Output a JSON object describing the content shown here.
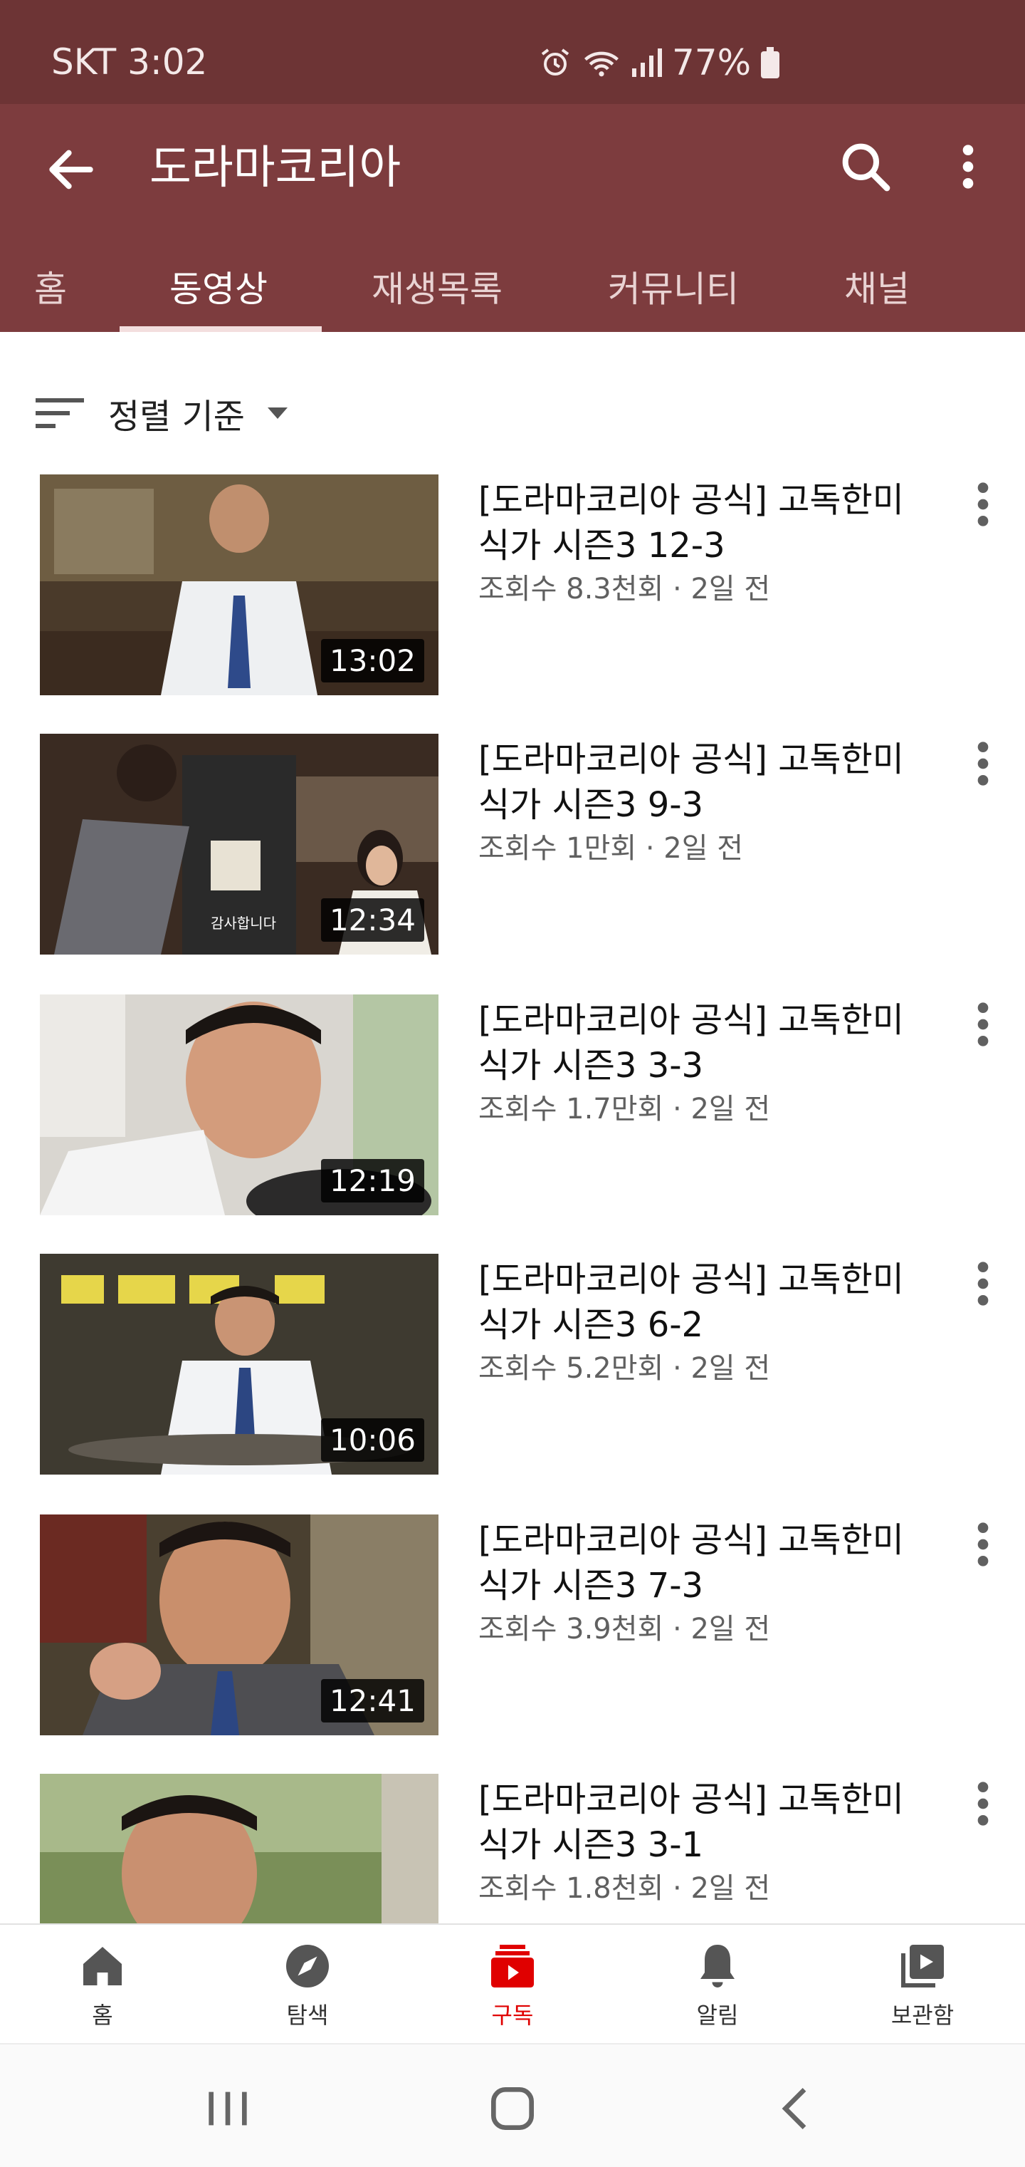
{
  "status_bar": {
    "carrier_time": "SKT 3:02",
    "battery": "77%"
  },
  "header": {
    "channel_title": "도라마코리아"
  },
  "tabs": [
    {
      "label": "홈"
    },
    {
      "label": "동영상",
      "active": true
    },
    {
      "label": "재생목록"
    },
    {
      "label": "커뮤니티"
    },
    {
      "label": "채널"
    }
  ],
  "sort": {
    "label": "정렬 기준"
  },
  "videos": [
    {
      "title": "[도라마코리아 공식] 고독한미식가 시즌3 12-3",
      "meta": "조회수 8.3천회 · 2일 전",
      "duration": "13:02"
    },
    {
      "title": "[도라마코리아 공식] 고독한미식가 시즌3 9-3",
      "meta": "조회수 1만회 · 2일 전",
      "duration": "12:34",
      "caption": "감사합니다"
    },
    {
      "title": "[도라마코리아 공식] 고독한미식가 시즌3 3-3",
      "meta": "조회수 1.7만회 · 2일 전",
      "duration": "12:19"
    },
    {
      "title": "[도라마코리아 공식] 고독한미식가 시즌3 6-2",
      "meta": "조회수 5.2만회 · 2일 전",
      "duration": "10:06"
    },
    {
      "title": "[도라마코리아 공식] 고독한미식가 시즌3 7-3",
      "meta": "조회수 3.9천회 · 2일 전",
      "duration": "12:41"
    },
    {
      "title": "[도라마코리아 공식] 고독한미식가 시즌3 3-1",
      "meta": "조회수 1.8천회 · 2일 전",
      "duration": ""
    }
  ],
  "bottom_nav": [
    {
      "label": "홈",
      "icon": "home-icon"
    },
    {
      "label": "탐색",
      "icon": "explore-icon"
    },
    {
      "label": "구독",
      "icon": "subscriptions-icon",
      "active": true
    },
    {
      "label": "알림",
      "icon": "bell-icon"
    },
    {
      "label": "보관함",
      "icon": "library-icon"
    }
  ],
  "colors": {
    "status_bar": "#6d3435",
    "app_bar": "#7d3c3e",
    "active_nav": "#e00000"
  }
}
